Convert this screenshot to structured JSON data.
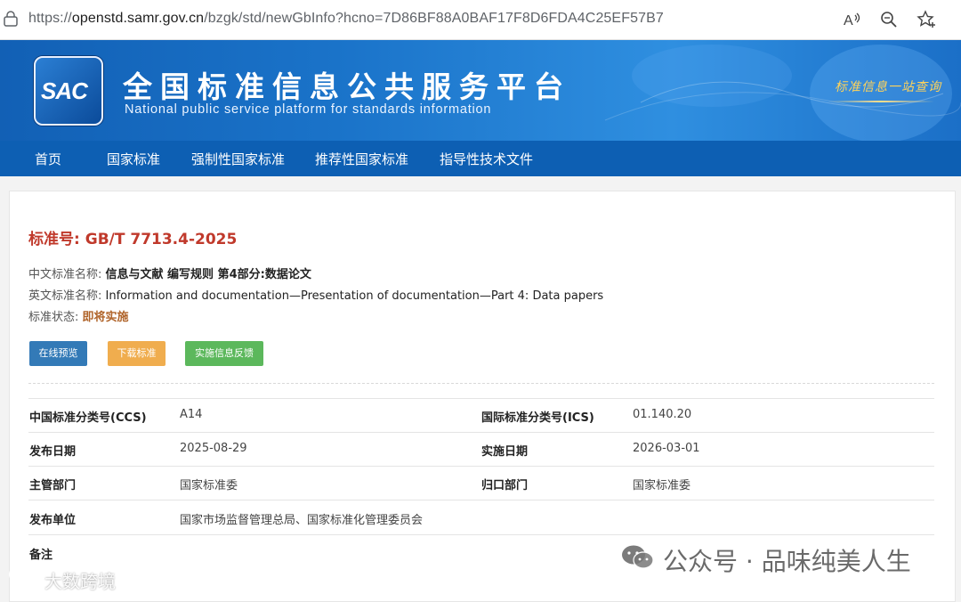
{
  "browser": {
    "url_prefix": "https://",
    "url_host": "openstd.samr.gov.cn",
    "url_path": "/bzgk/std/newGbInfo?hcno=7D86BF88A0BAF17F8D6FDA4C25EF57B7"
  },
  "header": {
    "logo_text": "SAC",
    "title_cn": "全国标准信息公共服务平台",
    "title_en": "National public service platform  for standards information",
    "slogan": "标准信息一站查询"
  },
  "nav": {
    "items": [
      "首页",
      "国家标准",
      "强制性国家标准",
      "推荐性国家标准",
      "指导性技术文件"
    ]
  },
  "standard": {
    "number_label": "标准号:",
    "number": "GB/T 7713.4-2025",
    "cn_name_label": "中文标准名称:",
    "cn_name": "信息与文献 编写规则 第4部分:数据论文",
    "en_name_label": "英文标准名称:",
    "en_name": "Information and documentation—Presentation of documentation—Part 4: Data papers",
    "status_label": "标准状态:",
    "status": "即将实施"
  },
  "actions": {
    "preview": "在线预览",
    "download": "下载标准",
    "feedback": "实施信息反馈"
  },
  "details": {
    "ccs_label": "中国标准分类号(CCS)",
    "ccs": "A14",
    "ics_label": "国际标准分类号(ICS)",
    "ics": "01.140.20",
    "publish_label": "发布日期",
    "publish": "2025-08-29",
    "effective_label": "实施日期",
    "effective": "2026-03-01",
    "authority_label": "主管部门",
    "authority": "国家标准委",
    "belong_label": "归口部门",
    "belong": "国家标准委",
    "issuer_label": "发布单位",
    "issuer": "国家市场监督管理总局、国家标准化管理委员会",
    "remark_label": "备注"
  },
  "watermarks": {
    "right": "公众号 · 品味纯美人生",
    "left": "大数跨境"
  },
  "colors": {
    "nav_bg": "#0d5fb3",
    "title_red": "#c0392b",
    "btn_blue": "#337ab7",
    "btn_orange": "#f0ad4e",
    "btn_green": "#5cb85c"
  }
}
